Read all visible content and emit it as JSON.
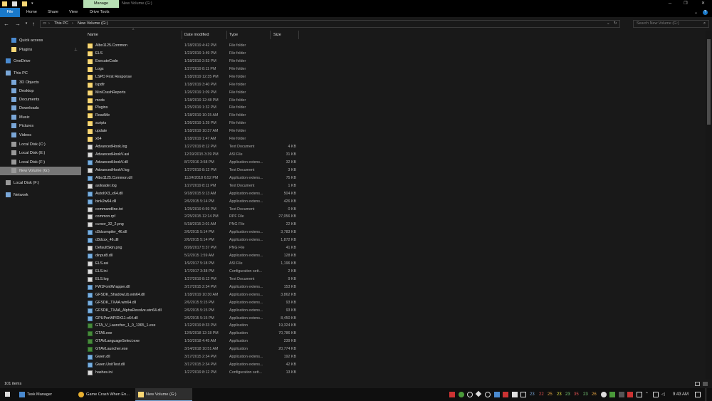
{
  "window": {
    "title": "New Volume (G:)",
    "manage_tab": "Manage"
  },
  "ribbon": {
    "tabs": [
      "File",
      "Home",
      "Share",
      "View",
      "Drive Tools"
    ],
    "help": "?"
  },
  "address": {
    "path": [
      "This PC",
      "New Volume (G:)"
    ],
    "search_placeholder": "Search New Volume (G:)"
  },
  "sidebar": {
    "items": [
      {
        "label": "Quick access",
        "icon": "star-icon",
        "type": "quick"
      },
      {
        "label": "Plugins",
        "icon": "folder-icon",
        "type": "folder"
      },
      {
        "label": "OneDrive",
        "icon": "cloud-icon",
        "type": "cloud"
      },
      {
        "label": "This PC",
        "icon": "pc-icon",
        "type": "pc"
      },
      {
        "label": "3D Objects",
        "icon": "cube-icon",
        "type": "lib"
      },
      {
        "label": "Desktop",
        "icon": "desktop-icon",
        "type": "lib"
      },
      {
        "label": "Documents",
        "icon": "documents-icon",
        "type": "lib"
      },
      {
        "label": "Downloads",
        "icon": "download-icon",
        "type": "lib"
      },
      {
        "label": "Music",
        "icon": "music-icon",
        "type": "lib"
      },
      {
        "label": "Pictures",
        "icon": "pictures-icon",
        "type": "lib"
      },
      {
        "label": "Videos",
        "icon": "videos-icon",
        "type": "lib"
      },
      {
        "label": "Local Disk (C:)",
        "icon": "drive-icon",
        "type": "drive"
      },
      {
        "label": "Local Disk (E:)",
        "icon": "drive-icon",
        "type": "drive"
      },
      {
        "label": "Local Disk (F:)",
        "icon": "drive-icon",
        "type": "drive"
      },
      {
        "label": "New Volume (G:)",
        "icon": "drive-icon",
        "type": "drive"
      },
      {
        "label": "Local Disk (F:)",
        "icon": "drive-icon",
        "type": "drive"
      },
      {
        "label": "Network",
        "icon": "network-icon",
        "type": "net"
      }
    ]
  },
  "columns": {
    "name": "Name",
    "date": "Date modified",
    "type": "Type",
    "size": "Size"
  },
  "files": [
    {
      "name": "Albo1125.Common",
      "date": "1/18/2019 4:42 PM",
      "type": "File folder",
      "size": "",
      "kind": "folder"
    },
    {
      "name": "ELS",
      "date": "1/23/2019 1:49 PM",
      "type": "File folder",
      "size": "",
      "kind": "folder"
    },
    {
      "name": "ExecuteCode",
      "date": "1/18/2019 2:53 PM",
      "type": "File folder",
      "size": "",
      "kind": "folder"
    },
    {
      "name": "Logs",
      "date": "1/27/2019 8:11 PM",
      "type": "File folder",
      "size": "",
      "kind": "folder"
    },
    {
      "name": "LSPD First Response",
      "date": "1/18/2019 12:35 PM",
      "type": "File folder",
      "size": "",
      "kind": "folder"
    },
    {
      "name": "lspdfr",
      "date": "1/18/2019 3:40 PM",
      "type": "File folder",
      "size": "",
      "kind": "folder"
    },
    {
      "name": "MiniCrashReports",
      "date": "1/26/2019 1:09 PM",
      "type": "File folder",
      "size": "",
      "kind": "folder"
    },
    {
      "name": "mods",
      "date": "1/18/2019 12:48 PM",
      "type": "File folder",
      "size": "",
      "kind": "folder"
    },
    {
      "name": "Plugins",
      "date": "1/25/2019 1:32 PM",
      "type": "File folder",
      "size": "",
      "kind": "folder"
    },
    {
      "name": "ReadMe",
      "date": "1/18/2019 10:15 AM",
      "type": "File folder",
      "size": "",
      "kind": "folder"
    },
    {
      "name": "scripts",
      "date": "1/26/2019 1:29 PM",
      "type": "File folder",
      "size": "",
      "kind": "folder"
    },
    {
      "name": "update",
      "date": "1/18/2019 10:37 AM",
      "type": "File folder",
      "size": "",
      "kind": "folder"
    },
    {
      "name": "x64",
      "date": "1/18/2019 1:47 AM",
      "type": "File folder",
      "size": "",
      "kind": "folder"
    },
    {
      "name": "AdvancedHook.log",
      "date": "1/27/2019 8:12 PM",
      "type": "Text Document",
      "size": "4 KB",
      "kind": "doc"
    },
    {
      "name": "AdvancedHookV.asi",
      "date": "12/19/2015 3:39 PM",
      "type": "ASI File",
      "size": "31 KB",
      "kind": "doc"
    },
    {
      "name": "AdvancedHookV.dll",
      "date": "8/7/2016 3:58 PM",
      "type": "Application extens...",
      "size": "32 KB",
      "kind": "app"
    },
    {
      "name": "AdvancedHookV.log",
      "date": "1/27/2019 8:12 PM",
      "type": "Text Document",
      "size": "3 KB",
      "kind": "doc"
    },
    {
      "name": "Albo1125.Common.dll",
      "date": "11/24/2018 6:52 PM",
      "type": "Application extens...",
      "size": "75 KB",
      "kind": "app"
    },
    {
      "name": "asiloader.log",
      "date": "1/27/2019 8:11 PM",
      "type": "Text Document",
      "size": "1 KB",
      "kind": "doc"
    },
    {
      "name": "AutoItX3_x64.dll",
      "date": "9/18/2015 9:13 AM",
      "type": "Application extens...",
      "size": "504 KB",
      "kind": "app"
    },
    {
      "name": "bink2w64.dll",
      "date": "2/6/2015 5:14 PM",
      "type": "Application extens...",
      "size": "426 KB",
      "kind": "app"
    },
    {
      "name": "commandline.txt",
      "date": "1/25/2019 6:59 PM",
      "type": "Text Document",
      "size": "0 KB",
      "kind": "doc"
    },
    {
      "name": "common.rpf",
      "date": "2/25/2015 12:14 PM",
      "type": "RPF File",
      "size": "27,056 KB",
      "kind": "doc"
    },
    {
      "name": "cursor_32_2.png",
      "date": "5/18/2015 2:01 AM",
      "type": "PNG File",
      "size": "22 KB",
      "kind": "doc"
    },
    {
      "name": "d3dcompiler_46.dll",
      "date": "2/6/2015 5:14 PM",
      "type": "Application extens...",
      "size": "3,783 KB",
      "kind": "app"
    },
    {
      "name": "d3dcsx_46.dll",
      "date": "2/6/2015 5:14 PM",
      "type": "Application extens...",
      "size": "1,872 KB",
      "kind": "app"
    },
    {
      "name": "DefaultSkin.png",
      "date": "8/26/2017 5:37 PM",
      "type": "PNG File",
      "size": "41 KB",
      "kind": "doc"
    },
    {
      "name": "dinput8.dll",
      "date": "5/2/2015 1:59 AM",
      "type": "Application extens...",
      "size": "128 KB",
      "kind": "app"
    },
    {
      "name": "ELS.asi",
      "date": "1/9/2017 5:18 PM",
      "type": "ASI File",
      "size": "1,196 KB",
      "kind": "doc"
    },
    {
      "name": "ELS.ini",
      "date": "1/7/2017 3:38 PM",
      "type": "Configuration sett...",
      "size": "2 KB",
      "kind": "doc"
    },
    {
      "name": "ELS.log",
      "date": "1/27/2019 8:12 PM",
      "type": "Text Document",
      "size": "9 KB",
      "kind": "doc"
    },
    {
      "name": "FW1FontWrapper.dll",
      "date": "3/17/2015 2:34 PM",
      "type": "Application extens...",
      "size": "153 KB",
      "kind": "app"
    },
    {
      "name": "GFSDK_ShadowLib.win64.dll",
      "date": "1/18/2019 10:30 AM",
      "type": "Application extens...",
      "size": "3,862 KB",
      "kind": "app"
    },
    {
      "name": "GFSDK_TXAA.win64.dll",
      "date": "2/6/2015 5:15 PM",
      "type": "Application extens...",
      "size": "93 KB",
      "kind": "app"
    },
    {
      "name": "GFSDK_TXAA_AlphaResolve.win64.dll",
      "date": "2/6/2015 5:15 PM",
      "type": "Application extens...",
      "size": "93 KB",
      "kind": "app"
    },
    {
      "name": "GPUPerfAPIDX11-x64.dll",
      "date": "2/6/2015 5:15 PM",
      "type": "Application extens...",
      "size": "8,450 KB",
      "kind": "app"
    },
    {
      "name": "GTA_V_Launcher_1_0_1365_1.exe",
      "date": "1/12/2019 8:33 PM",
      "type": "Application",
      "size": "19,324 KB",
      "kind": "exe"
    },
    {
      "name": "GTA5.exe",
      "date": "12/5/2018 12:18 PM",
      "type": "Application",
      "size": "70,786 KB",
      "kind": "exe"
    },
    {
      "name": "GTAVLanguageSelect.exe",
      "date": "1/10/2018 4:45 AM",
      "type": "Application",
      "size": "239 KB",
      "kind": "exe"
    },
    {
      "name": "GTAVLauncher.exe",
      "date": "3/14/2018 10:51 AM",
      "type": "Application",
      "size": "20,774 KB",
      "kind": "exe"
    },
    {
      "name": "Gwen.dll",
      "date": "3/17/2015 2:34 PM",
      "type": "Application extens...",
      "size": "192 KB",
      "kind": "app"
    },
    {
      "name": "Gwen.UnitTest.dll",
      "date": "3/17/2015 2:34 PM",
      "type": "Application extens...",
      "size": "42 KB",
      "kind": "app"
    },
    {
      "name": "hashes.ini",
      "date": "1/27/2019 8:12 PM",
      "type": "Configuration sett...",
      "size": "13 KB",
      "kind": "doc"
    }
  ],
  "status": {
    "items": "101 items"
  },
  "taskbar": {
    "buttons": [
      "Task Manager",
      "Game Crash When En...",
      "New Volume (G:)"
    ],
    "tray_numbers": [
      "23",
      "22",
      "25",
      "23",
      "23",
      "35",
      "23",
      "26"
    ],
    "time": "9:43 AM"
  }
}
